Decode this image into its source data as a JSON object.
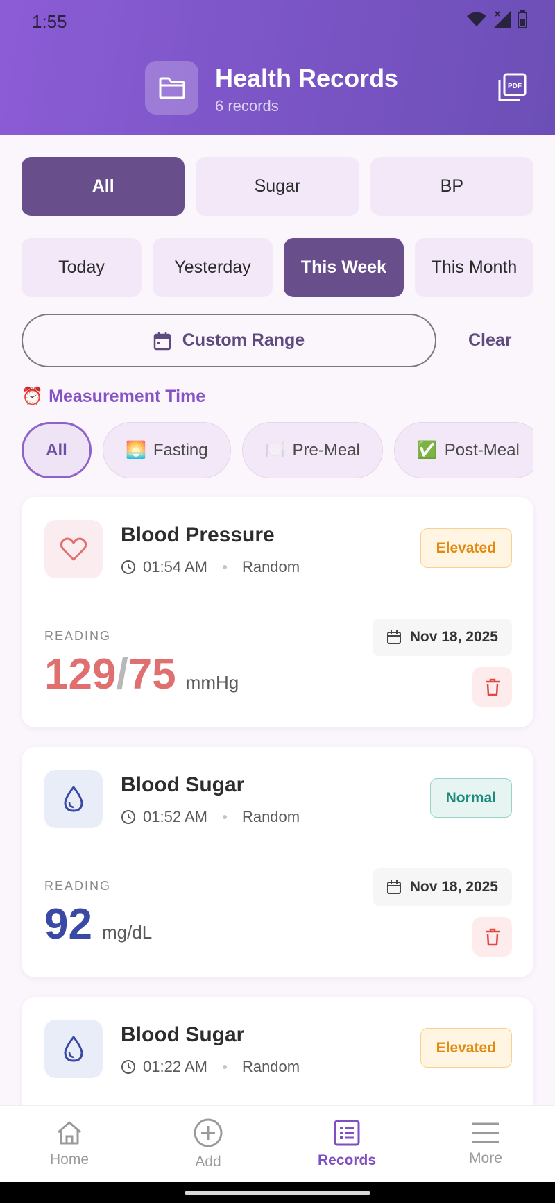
{
  "status_bar": {
    "time": "1:55"
  },
  "header": {
    "title": "Health Records",
    "subtitle": "6 records",
    "pdf_label": "PDF",
    "gradient": [
      "#8c5cd6",
      "#6c4fb6"
    ]
  },
  "type_filter": [
    {
      "label": "All",
      "active": true
    },
    {
      "label": "Sugar",
      "active": false
    },
    {
      "label": "BP",
      "active": false
    }
  ],
  "date_filter": [
    {
      "label": "Today",
      "active": false
    },
    {
      "label": "Yesterday",
      "active": false
    },
    {
      "label": "This Week",
      "active": true
    },
    {
      "label": "This Month",
      "active": false
    }
  ],
  "custom_range": {
    "label": "Custom Range",
    "clear_label": "Clear"
  },
  "measurement_time": {
    "label": "Measurement Time",
    "emoji": "⏰",
    "chips": [
      {
        "label": "All",
        "emoji": "",
        "active": true
      },
      {
        "label": "Fasting",
        "emoji": "🌅",
        "active": false
      },
      {
        "label": "Pre-Meal",
        "emoji": "🍽️",
        "active": false
      },
      {
        "label": "Post-Meal",
        "emoji": "✅",
        "active": false
      }
    ]
  },
  "records": [
    {
      "type": "bp",
      "title": "Blood Pressure",
      "time": "01:54 AM",
      "context": "Random",
      "status": "Elevated",
      "reading_label": "READING",
      "systolic": "129",
      "separator": "/",
      "diastolic": "75",
      "unit": "mmHg",
      "date": "Nov 18, 2025"
    },
    {
      "type": "sugar",
      "title": "Blood Sugar",
      "time": "01:52 AM",
      "context": "Random",
      "status": "Normal",
      "reading_label": "READING",
      "value": "92",
      "unit": "mg/dL",
      "date": "Nov 18, 2025"
    },
    {
      "type": "sugar",
      "title": "Blood Sugar",
      "time": "01:22 AM",
      "context": "Random",
      "status": "Elevated"
    }
  ],
  "bottom_nav": [
    {
      "label": "Home",
      "icon": "home-icon",
      "active": false
    },
    {
      "label": "Add",
      "icon": "add-circle-icon",
      "active": false
    },
    {
      "label": "Records",
      "icon": "records-list-icon",
      "active": true
    },
    {
      "label": "More",
      "icon": "menu-icon",
      "active": false
    }
  ],
  "colors": {
    "accent": "#684f8c",
    "bp_value": "#e07070",
    "sugar_value": "#3a4aa4",
    "elevated": "#e18a0f",
    "normal": "#1d8b7b"
  }
}
